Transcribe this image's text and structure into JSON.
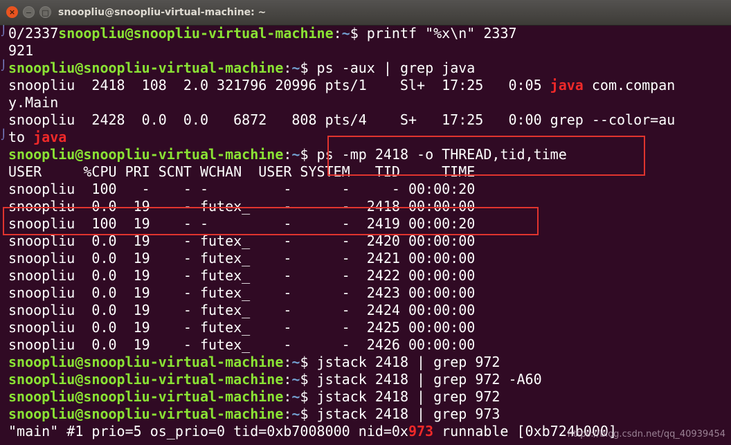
{
  "window": {
    "title": "snoopliu@snoopliu-virtual-machine: ~",
    "close_glyph": "×",
    "min_glyph": "−",
    "max_glyph": "□"
  },
  "colors": {
    "background": "#300a24",
    "prompt": "#8ae234",
    "path": "#729fcf",
    "highlight": "#ef2929",
    "annotation_box": "#e0342e"
  },
  "terminal": {
    "lines": [
      {
        "segments": [
          {
            "t": "0/2337",
            "c": "plain"
          },
          {
            "t": "snoopliu@snoopliu-virtual-machine",
            "c": "prompt"
          },
          {
            "t": ":",
            "c": "plain"
          },
          {
            "t": "~",
            "c": "path"
          },
          {
            "t": "$ printf \"%x\\n\" 2337",
            "c": "plain"
          }
        ]
      },
      {
        "segments": [
          {
            "t": "921",
            "c": "plain"
          }
        ]
      },
      {
        "segments": [
          {
            "t": "snoopliu@snoopliu-virtual-machine",
            "c": "prompt"
          },
          {
            "t": ":",
            "c": "plain"
          },
          {
            "t": "~",
            "c": "path"
          },
          {
            "t": "$ ps -aux | grep java",
            "c": "plain"
          }
        ]
      },
      {
        "segments": [
          {
            "t": "snoopliu  2418  108  2.0 321796 20996 pts/1    Sl+  17:25   0:05 ",
            "c": "plain"
          },
          {
            "t": "java",
            "c": "hl"
          },
          {
            "t": " com.compan",
            "c": "plain"
          }
        ]
      },
      {
        "segments": [
          {
            "t": "y.Main",
            "c": "plain"
          }
        ]
      },
      {
        "segments": [
          {
            "t": "snoopliu  2428  0.0  0.0   6872   808 pts/4    S+   17:25   0:00 grep --color=au",
            "c": "plain"
          }
        ]
      },
      {
        "segments": [
          {
            "t": "to ",
            "c": "plain"
          },
          {
            "t": "java",
            "c": "hl"
          }
        ]
      },
      {
        "segments": [
          {
            "t": "snoopliu@snoopliu-virtual-machine",
            "c": "prompt"
          },
          {
            "t": ":",
            "c": "plain"
          },
          {
            "t": "~",
            "c": "path"
          },
          {
            "t": "$ ps -mp 2418 -o THREAD,tid,time",
            "c": "plain"
          }
        ]
      },
      {
        "segments": [
          {
            "t": "USER     %CPU PRI SCNT WCHAN  USER SYSTEM   TID     TIME",
            "c": "plain"
          }
        ]
      },
      {
        "segments": [
          {
            "t": "snoopliu  100   -    - -         -      -     - 00:00:20",
            "c": "plain"
          }
        ]
      },
      {
        "segments": [
          {
            "t": "snoopliu  0.0  19    - futex_    -      -  2418 00:00:00",
            "c": "plain"
          }
        ]
      },
      {
        "segments": [
          {
            "t": "snoopliu  100  19    - -         -      -  2419 00:00:20",
            "c": "plain"
          }
        ]
      },
      {
        "segments": [
          {
            "t": "snoopliu  0.0  19    - futex_    -      -  2420 00:00:00",
            "c": "plain"
          }
        ]
      },
      {
        "segments": [
          {
            "t": "snoopliu  0.0  19    - futex_    -      -  2421 00:00:00",
            "c": "plain"
          }
        ]
      },
      {
        "segments": [
          {
            "t": "snoopliu  0.0  19    - futex_    -      -  2422 00:00:00",
            "c": "plain"
          }
        ]
      },
      {
        "segments": [
          {
            "t": "snoopliu  0.0  19    - futex_    -      -  2423 00:00:00",
            "c": "plain"
          }
        ]
      },
      {
        "segments": [
          {
            "t": "snoopliu  0.0  19    - futex_    -      -  2424 00:00:00",
            "c": "plain"
          }
        ]
      },
      {
        "segments": [
          {
            "t": "snoopliu  0.0  19    - futex_    -      -  2425 00:00:00",
            "c": "plain"
          }
        ]
      },
      {
        "segments": [
          {
            "t": "snoopliu  0.0  19    - futex_    -      -  2426 00:00:00",
            "c": "plain"
          }
        ]
      },
      {
        "segments": [
          {
            "t": "snoopliu@snoopliu-virtual-machine",
            "c": "prompt"
          },
          {
            "t": ":",
            "c": "plain"
          },
          {
            "t": "~",
            "c": "path"
          },
          {
            "t": "$ jstack 2418 | grep 972",
            "c": "plain"
          }
        ]
      },
      {
        "segments": [
          {
            "t": "snoopliu@snoopliu-virtual-machine",
            "c": "prompt"
          },
          {
            "t": ":",
            "c": "plain"
          },
          {
            "t": "~",
            "c": "path"
          },
          {
            "t": "$ jstack 2418 | grep 972 -A60",
            "c": "plain"
          }
        ]
      },
      {
        "segments": [
          {
            "t": "snoopliu@snoopliu-virtual-machine",
            "c": "prompt"
          },
          {
            "t": ":",
            "c": "plain"
          },
          {
            "t": "~",
            "c": "path"
          },
          {
            "t": "$ jstack 2418 | grep 972",
            "c": "plain"
          }
        ]
      },
      {
        "segments": [
          {
            "t": "snoopliu@snoopliu-virtual-machine",
            "c": "prompt"
          },
          {
            "t": ":",
            "c": "plain"
          },
          {
            "t": "~",
            "c": "path"
          },
          {
            "t": "$ jstack 2418 | grep 973",
            "c": "plain"
          }
        ]
      },
      {
        "segments": [
          {
            "t": "\"main\" #1 prio=5 os_prio=0 tid=0xb7008000 nid=0x",
            "c": "plain"
          },
          {
            "t": "973",
            "c": "hl"
          },
          {
            "t": " runnable [0xb724b000]",
            "c": "plain"
          }
        ]
      }
    ]
  },
  "watermark": "https://blog.csdn.net/qq_40939454"
}
